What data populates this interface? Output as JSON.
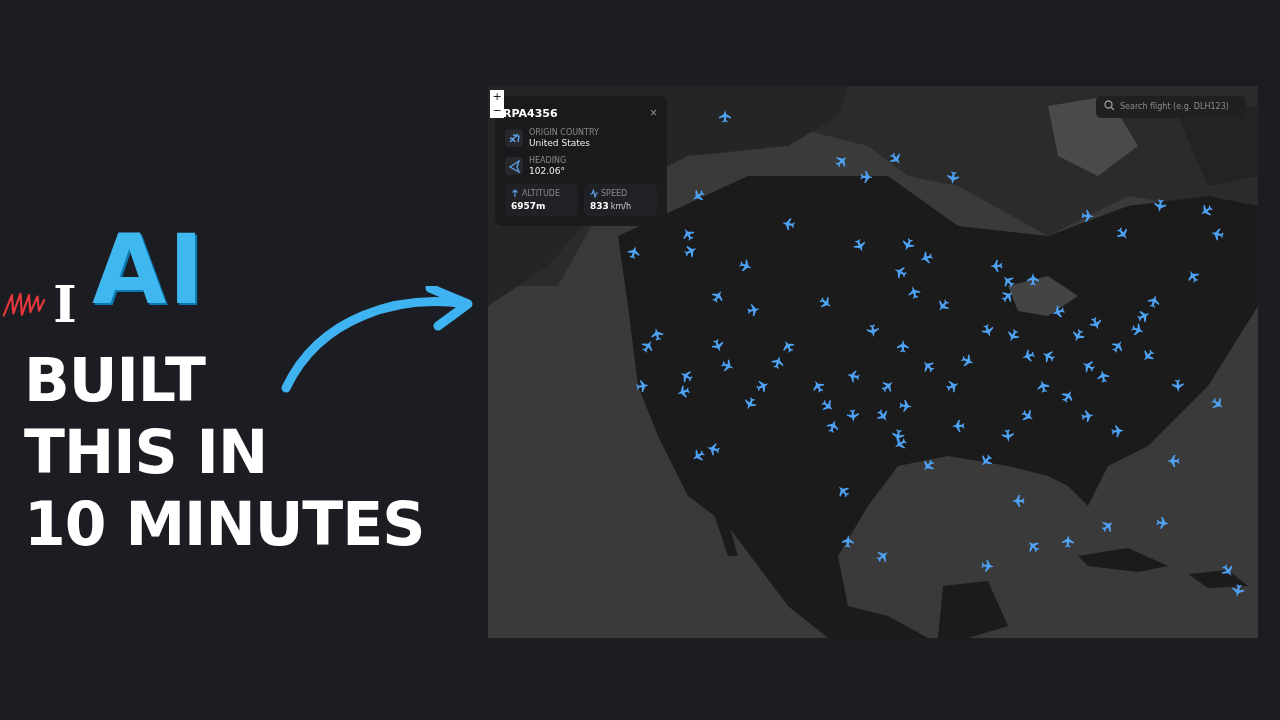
{
  "thumbnail": {
    "logo": {
      "struck_letter": "I",
      "word": "AI"
    },
    "headline": [
      "BUILT",
      "THIS IN",
      "10 MINUTES"
    ]
  },
  "app": {
    "zoom_controls": [
      "+",
      "−"
    ],
    "flight_panel": {
      "callsign": "RPA4356",
      "close": "×",
      "fields": [
        {
          "kind": "origin",
          "label": "ORIGIN COUNTRY",
          "value": "United States"
        },
        {
          "kind": "heading",
          "label": "HEADING",
          "value": "102.06°"
        }
      ],
      "stats": [
        {
          "kind": "altitude",
          "label": "ALTITUDE",
          "value": "6957m"
        },
        {
          "kind": "speed",
          "label": "SPEED",
          "value": "833",
          "unit": "km/h"
        }
      ]
    },
    "search": {
      "placeholder": "Search flight (e.g. DLH123)"
    }
  }
}
